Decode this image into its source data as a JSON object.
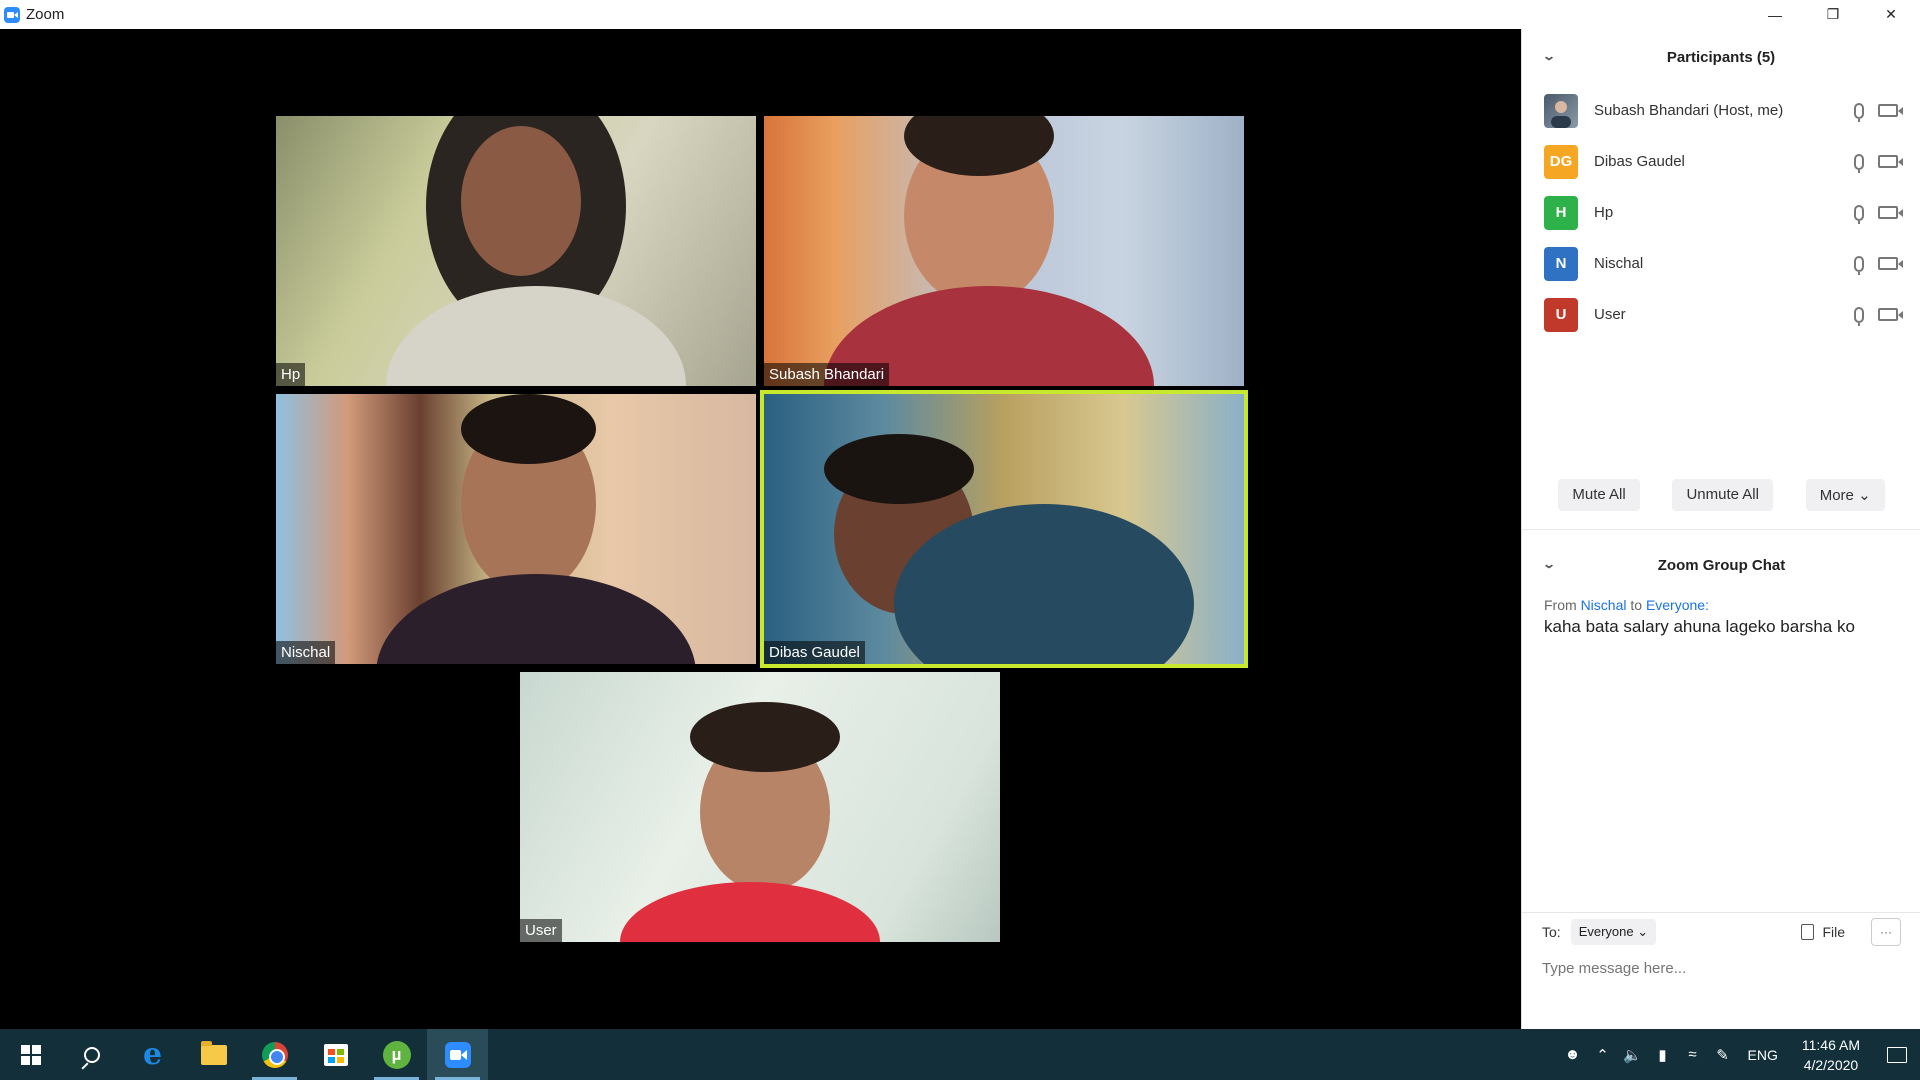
{
  "window": {
    "title": "Zoom"
  },
  "participants": {
    "header": "Participants (5)",
    "list": [
      {
        "name": "Subash Bhandari (Host, me)",
        "initials": "",
        "color": "#5a6a7a"
      },
      {
        "name": "Dibas Gaudel",
        "initials": "DG",
        "color": "#f5a623"
      },
      {
        "name": "Hp",
        "initials": "H",
        "color": "#2db24a"
      },
      {
        "name": "Nischal",
        "initials": "N",
        "color": "#2f72c4"
      },
      {
        "name": "User",
        "initials": "U",
        "color": "#c0392b"
      }
    ],
    "actions": {
      "mute_all": "Mute All",
      "unmute_all": "Unmute All",
      "more": "More"
    }
  },
  "videos": [
    {
      "name": "Hp"
    },
    {
      "name": "Subash Bhandari"
    },
    {
      "name": "Nischal"
    },
    {
      "name": "Dibas Gaudel"
    },
    {
      "name": "User"
    }
  ],
  "chat": {
    "header": "Zoom Group Chat",
    "messages": [
      {
        "from_label": "From",
        "from": "Nischal",
        "to_label": "to",
        "to": "Everyone:",
        "text": "kaha bata salary ahuna lageko barsha ko"
      }
    ],
    "to_label": "To:",
    "to_value": "Everyone",
    "file_label": "File",
    "placeholder": "Type message here..."
  },
  "taskbar": {
    "language": "ENG",
    "time": "11:46 AM",
    "date": "4/2/2020"
  }
}
